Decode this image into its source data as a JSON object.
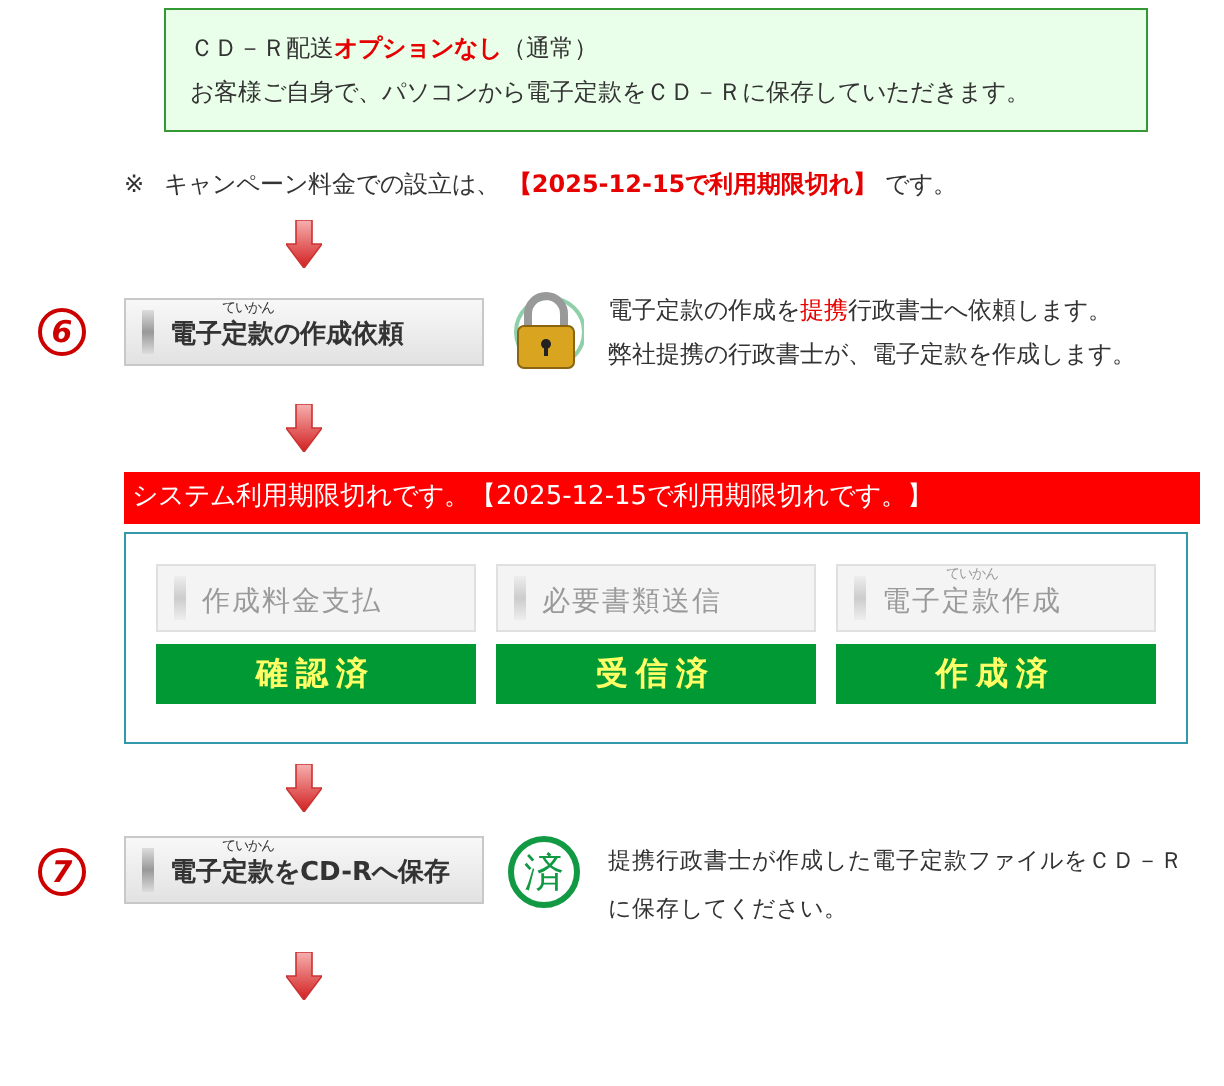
{
  "option_box": {
    "title": "ＣＤ－Ｒ配送**オプションなし**（通常）",
    "text": "お客様ご自身で、パソコンから電子定款をＣＤ－Ｒに保存していただきます。"
  },
  "note": {
    "mark": "※",
    "text": "キャンペーン料金での設立は、 **【2025-12-15で利用期限切れ】** です。"
  },
  "step6": {
    "number": "6",
    "button": {
      "pre": "電子",
      "base": "定款",
      "ruby": "ていかん",
      "post": "の作成依頼",
      "disabled": false
    },
    "lines": [
      "電子定款の作成を**提携**行政書士へ依頼します。",
      "弊社提携の行政書士が、電子定款を作成します。"
    ]
  },
  "alert": "システム利用期限切れです。【2025-12-15で利用期限切れです。】",
  "tasks": [
    {
      "button": {
        "pre": "作成料金支払",
        "disabled": true
      },
      "status": "確認済"
    },
    {
      "button": {
        "pre": "必要書類送信",
        "disabled": true
      },
      "status": "受信済"
    },
    {
      "button": {
        "pre": "電子",
        "base": "定款",
        "ruby": "ていかん",
        "post": "作成",
        "disabled": true
      },
      "status": "作成済"
    }
  ],
  "step7": {
    "number": "7",
    "button": {
      "pre": "電子",
      "base": "定款",
      "ruby": "ていかん",
      "post": "をCD-Rへ保存",
      "disabled": false
    },
    "stamp": "済",
    "text": "提携行政書士が作成した電子定款ファイルをＣＤ－Ｒに保存してください。"
  }
}
